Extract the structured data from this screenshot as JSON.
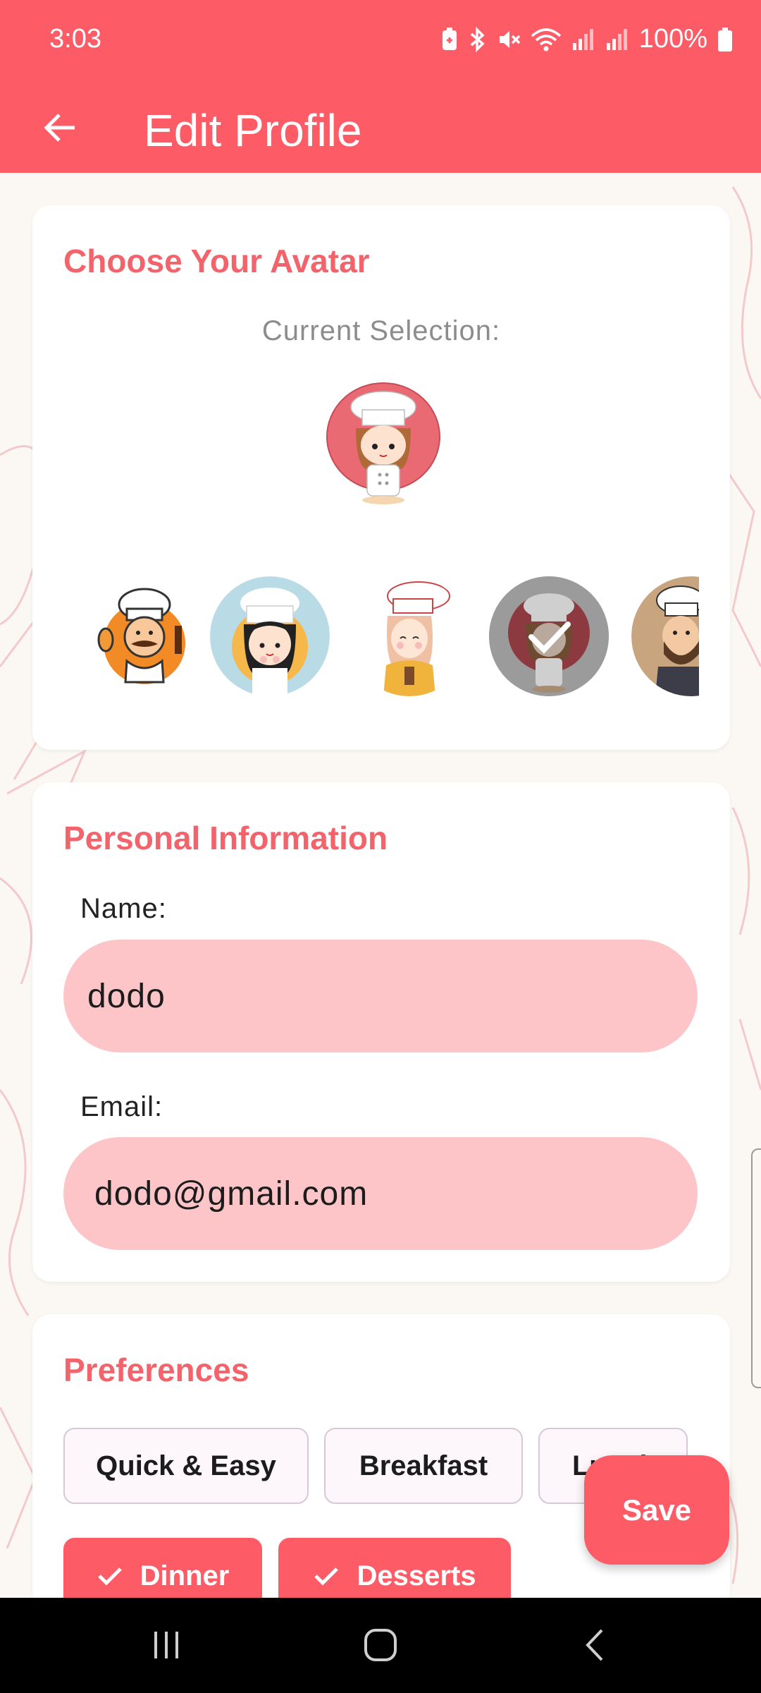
{
  "status_bar": {
    "time": "3:03",
    "battery": "100%"
  },
  "app_bar": {
    "title": "Edit Profile",
    "back_icon": "arrow-left-icon"
  },
  "avatar_section": {
    "title": "Choose Your Avatar",
    "current_label": "Current Selection:",
    "options": [
      {
        "name": "chef-mustache-spoon",
        "selected": false
      },
      {
        "name": "chef-girl-blue",
        "selected": false
      },
      {
        "name": "chef-girl-yellow",
        "selected": false
      },
      {
        "name": "chef-girl-red",
        "selected": true
      },
      {
        "name": "chef-bearded",
        "selected": false
      }
    ]
  },
  "personal_info": {
    "title": "Personal Information",
    "name_label": "Name:",
    "name_value": "dodo",
    "email_label": "Email:",
    "email_value": "dodo@gmail.com"
  },
  "preferences": {
    "title": "Preferences",
    "chips": [
      {
        "label": "Quick & Easy",
        "selected": false
      },
      {
        "label": "Breakfast",
        "selected": false
      },
      {
        "label": "Lunch",
        "selected": false
      },
      {
        "label": "Dinner",
        "selected": true
      },
      {
        "label": "Desserts",
        "selected": true
      }
    ]
  },
  "save_button": {
    "label": "Save"
  },
  "nav_bar": {
    "icons": [
      "recent-apps-icon",
      "home-icon",
      "back-icon"
    ]
  },
  "colors": {
    "accent": "#fd5c66",
    "field_bg": "#fdc5c8",
    "title_color": "#f2636b"
  }
}
